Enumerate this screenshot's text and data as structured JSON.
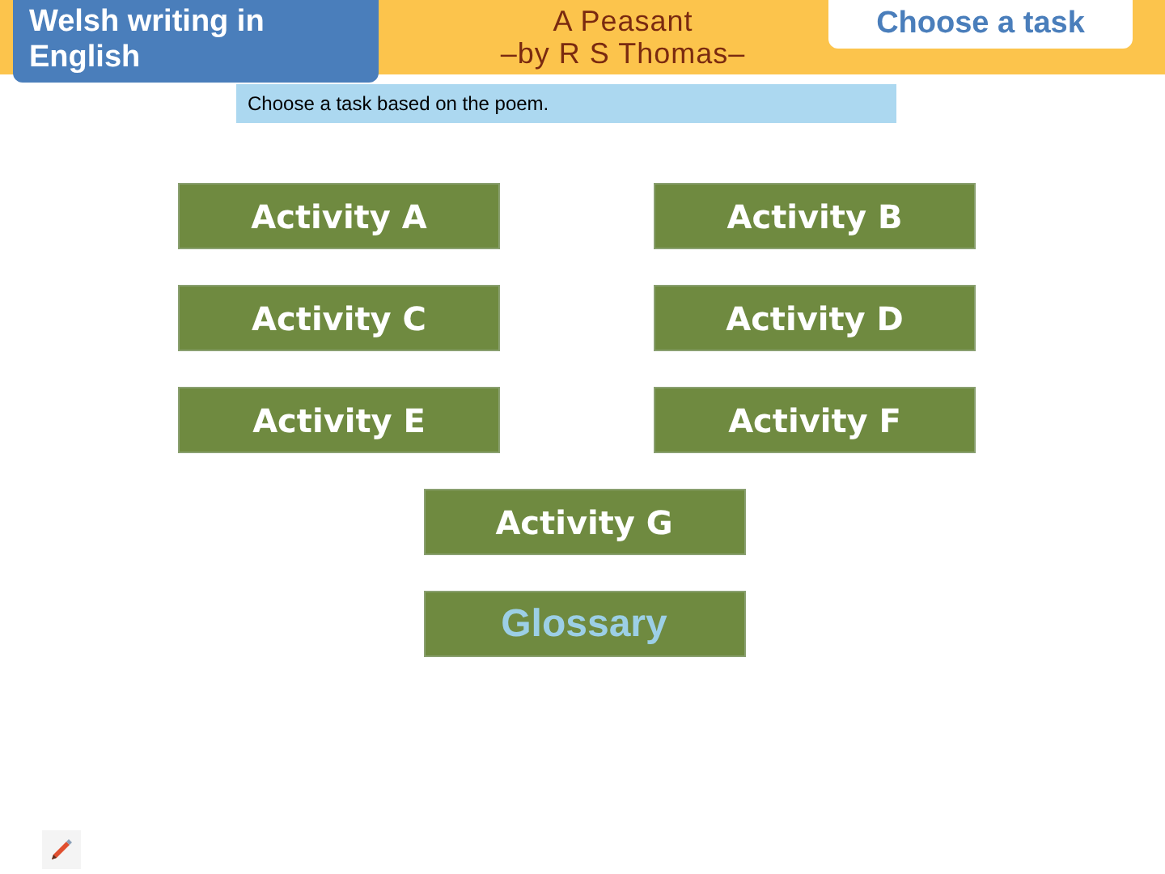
{
  "header": {
    "subject": "Welsh writing in English",
    "title": "A Peasant",
    "subtitle": "–by R S Thomas–",
    "page_label": "Choose a task"
  },
  "instruction": "Choose a task based on the poem.",
  "tasks": [
    {
      "label": "Activity A",
      "kind": "activity"
    },
    {
      "label": "Activity B",
      "kind": "activity"
    },
    {
      "label": "Activity C",
      "kind": "activity"
    },
    {
      "label": "Activity D",
      "kind": "activity"
    },
    {
      "label": "Activity E",
      "kind": "activity"
    },
    {
      "label": "Activity F",
      "kind": "activity"
    },
    {
      "label": "Activity G",
      "kind": "activity"
    },
    {
      "label": "Glossary",
      "kind": "glossary"
    }
  ]
}
